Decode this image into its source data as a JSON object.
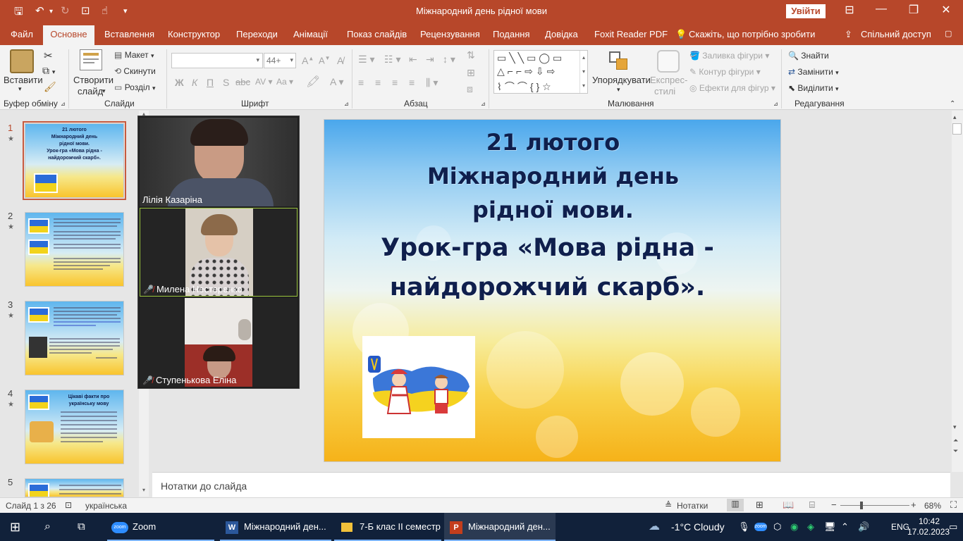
{
  "window": {
    "title": "Міжнародний день рідної мови",
    "signin_label": "Увійти"
  },
  "menu": {
    "items": [
      "Файл",
      "Основне",
      "Вставлення",
      "Конструктор",
      "Переходи",
      "Анімації",
      "Показ слайдів",
      "Рецензування",
      "Подання",
      "Довідка",
      "Foxit Reader PDF"
    ],
    "tell_me": "Скажіть, що потрібно зробити",
    "share": "Спільний доступ"
  },
  "ribbon": {
    "clipboard": {
      "paste": "Вставити",
      "group": "Буфер обміну"
    },
    "slides": {
      "new_slide_1": "Створити",
      "new_slide_2": "слайд",
      "layout": "Макет",
      "reset": "Скинути",
      "section": "Розділ",
      "group": "Слайди"
    },
    "font": {
      "font_size": "44+",
      "group": "Шрифт"
    },
    "paragraph": {
      "group": "Абзац"
    },
    "drawing": {
      "arrange": "Упорядкувати",
      "quick_styles_1": "Експрес-",
      "quick_styles_2": "стилі",
      "fill": "Заливка фігури",
      "outline": "Контур фігури",
      "effects": "Ефекти для фігур",
      "group": "Малювання"
    },
    "editing": {
      "find": "Знайти",
      "replace": "Замінити",
      "select": "Виділити",
      "group": "Редагування"
    }
  },
  "thumbnails": [
    {
      "num": "1",
      "title_lines": [
        "21 лютого",
        "Міжнародний день",
        "рідної мови.",
        "Урок-гра «Мова рідна -",
        "найдорожчий скарб»."
      ]
    },
    {
      "num": "2"
    },
    {
      "num": "3"
    },
    {
      "num": "4",
      "title_lines": [
        "Цікаві факти про",
        "українську мову"
      ]
    },
    {
      "num": "5"
    }
  ],
  "zoom": {
    "participants": [
      {
        "name": "Лілія Казаріна",
        "muted": false
      },
      {
        "name": "Милена Нестеренко",
        "muted": true
      },
      {
        "name": "Ступенькова Еліна",
        "muted": true
      }
    ]
  },
  "slide": {
    "line1": "21 лютого",
    "line2": "Міжнародний день",
    "line3": "рідної мови.",
    "line4": "Урок-гра  «Мова рідна -",
    "line5": "найдорожчий скарб»."
  },
  "notes": {
    "placeholder": "Нотатки до слайда"
  },
  "status": {
    "slide_counter": "Слайд 1 з 26",
    "language": "українська",
    "notes_btn": "Нотатки",
    "zoom": "68%"
  },
  "taskbar": {
    "apps": [
      {
        "label": "Zoom"
      },
      {
        "label": "Міжнародний ден..."
      },
      {
        "label": "7-Б клас ІІ семестр"
      },
      {
        "label": "Міжнародний ден..."
      }
    ],
    "weather": "-1°C  Cloudy",
    "lang": "ENG",
    "time": "10:42",
    "date": "17.02.2023"
  },
  "colors": {
    "accent": "#b7472a",
    "slide_title": "#0f1f4d",
    "taskbar": "#11213a"
  }
}
